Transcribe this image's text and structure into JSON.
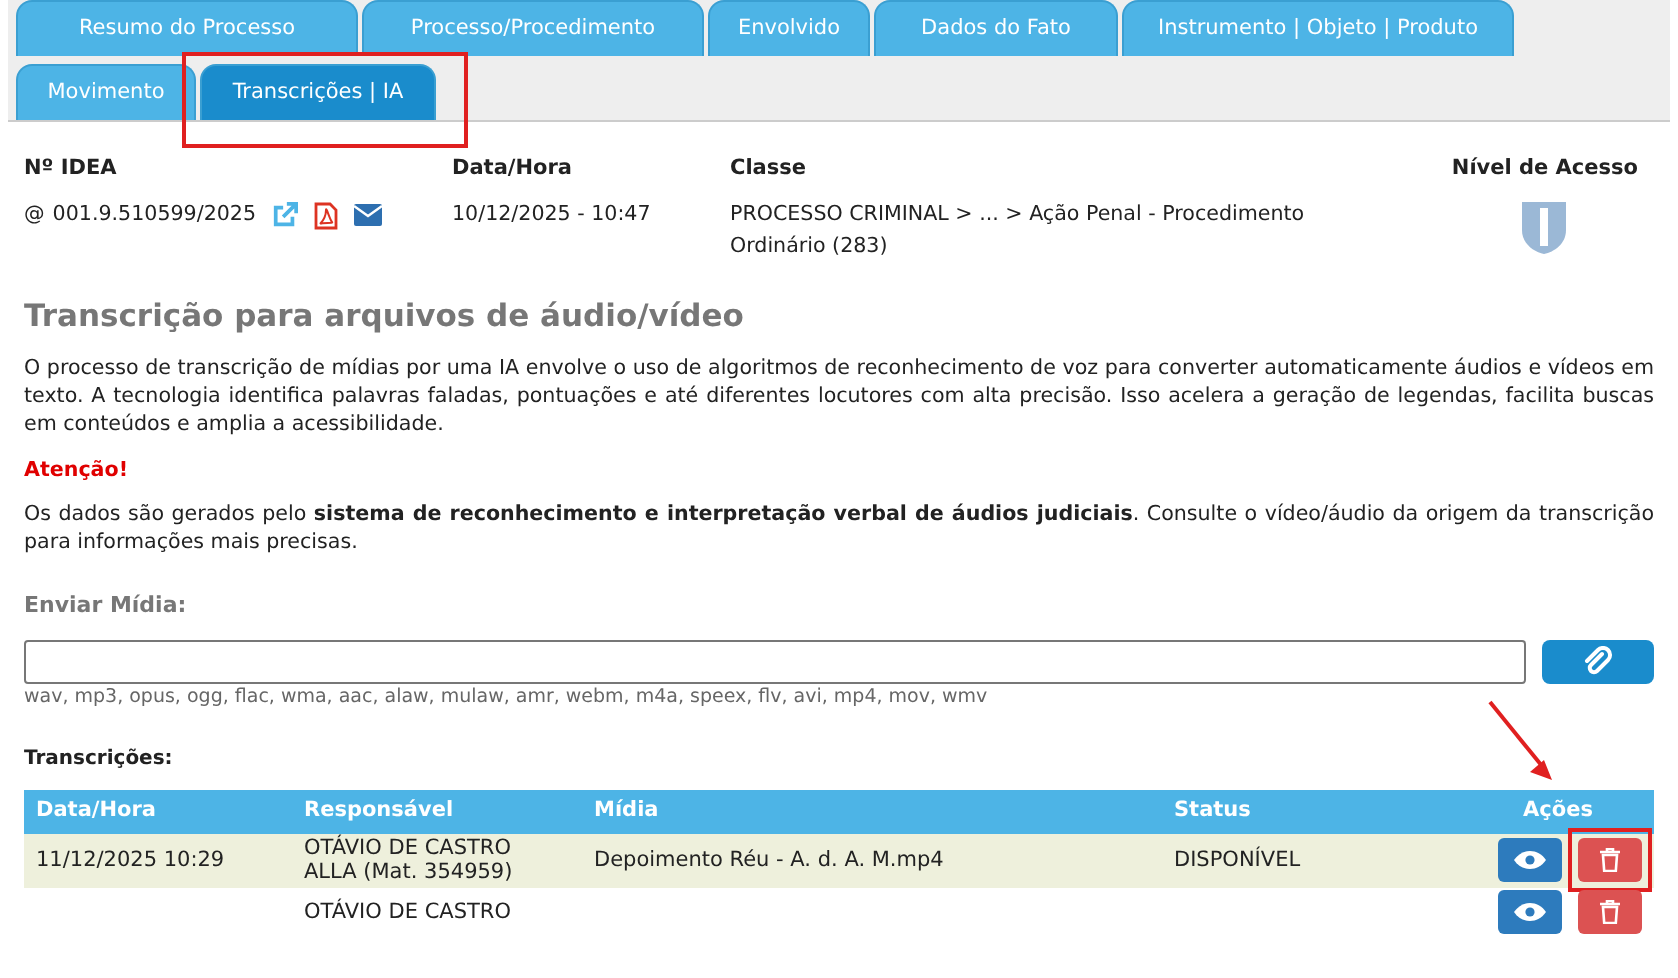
{
  "tab_rows": [
    {
      "tabs": [
        {
          "label": "Resumo do Processo",
          "selected": false
        },
        {
          "label": "Processo/Procedimento",
          "selected": false
        },
        {
          "label": "Envolvido",
          "selected": false
        },
        {
          "label": "Dados do Fato",
          "selected": false
        },
        {
          "label": "Instrumento | Objeto | Produto",
          "selected": false
        }
      ]
    },
    {
      "tabs": [
        {
          "label": "Movimento",
          "selected": false
        },
        {
          "label": "Transcrições | IA",
          "selected": true,
          "highlighted": true
        }
      ]
    }
  ],
  "header": {
    "columns": [
      {
        "label": "Nº IDEA",
        "kind": "idea",
        "value": "001.9.510599/2025",
        "prefix": "@"
      },
      {
        "label": "Data/Hora",
        "kind": "text",
        "value": "10/12/2025 - 10:47"
      },
      {
        "label": "Classe",
        "kind": "text",
        "value": "PROCESSO CRIMINAL > ... > Ação Penal - Procedimento Ordinário (283)"
      },
      {
        "label": "Nível de Acesso",
        "kind": "shield"
      }
    ]
  },
  "title": "Transcrição para arquivos de áudio/vídeo",
  "intro": "O processo de transcrição de mídias por uma IA envolve o uso de algoritmos de reconhecimento de voz para converter automaticamente áudios e vídeos em texto. A tecnologia identifica palavras faladas, pontuações e até diferentes locutores com alta precisão. Isso acelera a geração de legendas, facilita buscas em conteúdos e amplia a acessibilidade.",
  "warning": "Atenção!",
  "notice": "Os dados são gerados pelo **sistema de reconhecimento e interpretação verbal de áudios judiciais**. Consulte o vídeo/áudio da origem da transcrição para informações mais precisas.",
  "upload": {
    "label": "Enviar Mídia:",
    "formats": "wav, mp3, opus, ogg, flac, wma, aac, alaw, mulaw, amr, webm, m4a, speex, flv, avi, mp4, mov, wmv"
  },
  "table": {
    "caption": "Transcrições:",
    "columns": [
      "Data/Hora",
      "Responsável",
      "Mídia",
      "Status",
      "Ações"
    ],
    "rows": [
      {
        "cells": [
          "11/12/2025 10:29",
          "OTÁVIO DE CASTRO ALLA (Mat. 354959)",
          "Depoimento Réu - A. d. A. M.mp4",
          "DISPONÍVEL"
        ],
        "delete_highlighted": true
      },
      {
        "cells": [
          "",
          "OTÁVIO DE CASTRO",
          "",
          ""
        ]
      }
    ]
  }
}
